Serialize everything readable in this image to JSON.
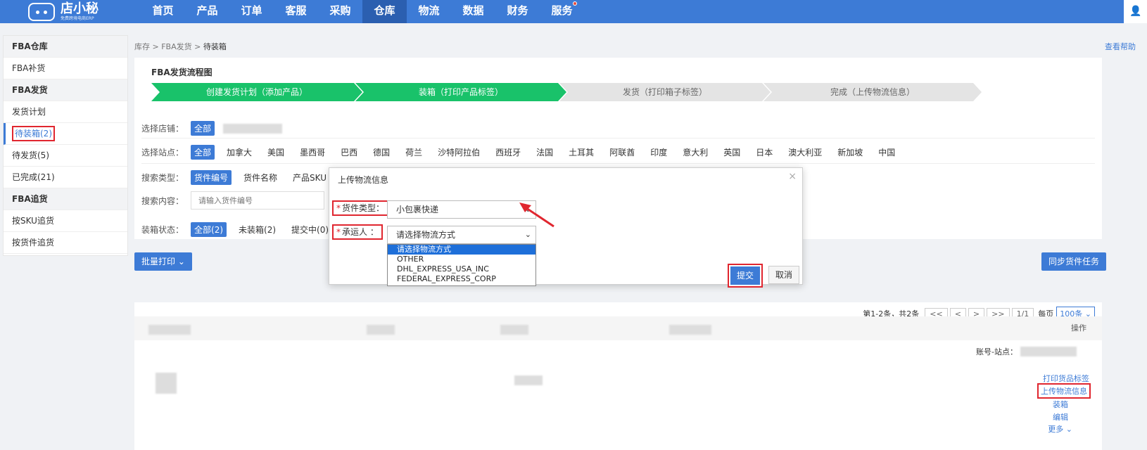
{
  "logo": {
    "name": "店小秘",
    "sub": "免费跨境电商ERP"
  },
  "nav": [
    {
      "label": "首页"
    },
    {
      "label": "产品"
    },
    {
      "label": "订单"
    },
    {
      "label": "客服"
    },
    {
      "label": "采购"
    },
    {
      "label": "仓库"
    },
    {
      "label": "物流"
    },
    {
      "label": "数据"
    },
    {
      "label": "财务"
    },
    {
      "label": "服务"
    }
  ],
  "sidebar": [
    {
      "label": "FBA仓库"
    },
    {
      "label": "FBA补货"
    },
    {
      "label": "FBA发货"
    },
    {
      "label": "发货计划"
    },
    {
      "label": "待装箱(2)"
    },
    {
      "label": "待发货(5)"
    },
    {
      "label": "已完成(21)"
    },
    {
      "label": "FBA追货"
    },
    {
      "label": "按SKU追货"
    },
    {
      "label": "按货件追货"
    }
  ],
  "breadcrumb": {
    "path": "库存 > FBA发货 > ",
    "current": "待装箱"
  },
  "help": "查看帮助",
  "flow": {
    "title": "FBA发货流程图",
    "steps": [
      "创建发货计划（添加产品）",
      "装箱（打印产品标签）",
      "发货（打印箱子标签）",
      "完成（上传物流信息）"
    ]
  },
  "filters": {
    "store_label": "选择店铺：",
    "all": "全部",
    "site_label": "选择站点：",
    "sites": [
      "加拿大",
      "美国",
      "墨西哥",
      "巴西",
      "德国",
      "荷兰",
      "沙特阿拉伯",
      "西班牙",
      "法国",
      "土耳其",
      "阿联酋",
      "印度",
      "意大利",
      "英国",
      "日本",
      "澳大利亚",
      "新加坡",
      "中国"
    ],
    "search_type_label": "搜索类型：",
    "search_types": [
      "货件编号",
      "货件名称",
      "产品SKU"
    ],
    "search_content_label": "搜索内容：",
    "search_placeholder": "请输入货件编号",
    "box_status_label": "装箱状态：",
    "box_status": [
      "全部(2)",
      "未装箱(2)",
      "提交中(0)"
    ]
  },
  "buttons": {
    "batch_print": "批量打印",
    "sync": "同步货件任务"
  },
  "pager": {
    "summary": "第1-2条，共2条",
    "first": "<<",
    "prev": "<",
    "next": ">",
    "last": ">>",
    "page": "1/1",
    "per_page_label": "每页",
    "per_page": "100条"
  },
  "table": {
    "ops_header": "操作",
    "account_label": "账号-站点：",
    "actions": [
      "打印货品标签",
      "上传物流信息",
      "装箱",
      "编辑",
      "更多"
    ]
  },
  "dialog": {
    "title": "上传物流信息",
    "close": "×",
    "cargo_type_label": "货件类型：",
    "cargo_type_value": "小包裹快递",
    "carrier_label": "承运人 ：",
    "carrier_value": "请选择物流方式",
    "carrier_options": [
      "请选择物流方式",
      "OTHER",
      "DHL_EXPRESS_USA_INC",
      "FEDERAL_EXPRESS_CORP"
    ],
    "submit": "提交",
    "cancel": "取消"
  },
  "colors": {
    "brand": "#3d7bd6",
    "step_done": "#19c26a",
    "highlight": "#e0262f"
  }
}
